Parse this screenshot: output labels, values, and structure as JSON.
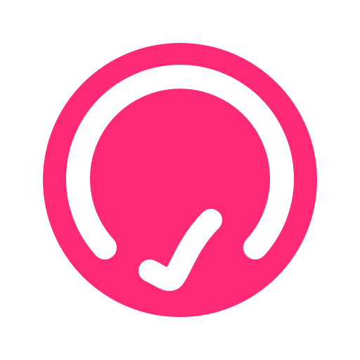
{
  "icon": {
    "name": "check-gauge-logo-icon",
    "colors": {
      "brand": "#FF2A77",
      "mark": "#FFFFFF",
      "background": "#FFFFFF"
    }
  }
}
